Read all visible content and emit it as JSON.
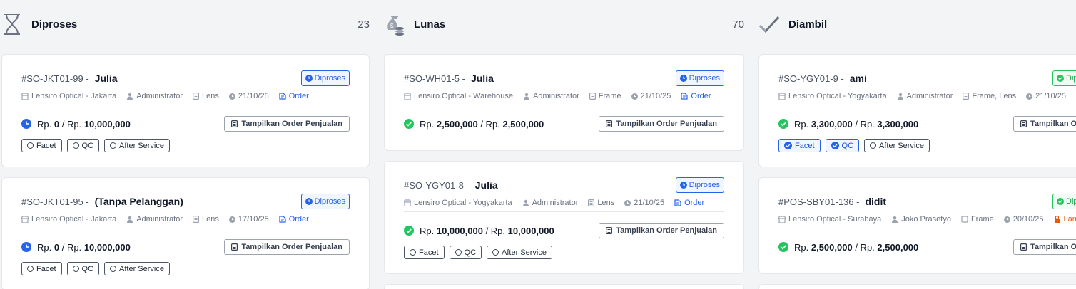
{
  "columns": [
    {
      "title": "Diproses",
      "count": "23",
      "icon": "hourglass-icon",
      "cards": [
        {
          "order_no": "#SO-JKT01-99 -",
          "customer": "Julia",
          "status": "Diproses",
          "branch": "Lensiro Optical - Jakarta",
          "user": "Administrator",
          "items": "Lens",
          "date": "21/10/25",
          "type": "Order",
          "paid_prefix": "Rp.",
          "paid": "0",
          "separator": "/ Rp.",
          "total": "10,000,000",
          "button": "Tampilkan Order Penjualan",
          "chips": [
            {
              "label": "Facet",
              "checked": false
            },
            {
              "label": "QC",
              "checked": false
            },
            {
              "label": "After Service",
              "checked": false
            }
          ]
        },
        {
          "order_no": "#SO-JKT01-95 -",
          "customer": "(Tanpa Pelanggan)",
          "status": "Diproses",
          "branch": "Lensiro Optical - Jakarta",
          "user": "Administrator",
          "items": "Lens",
          "date": "17/10/25",
          "type": "Order",
          "paid_prefix": "Rp.",
          "paid": "0",
          "separator": "/ Rp.",
          "total": "10,000,000",
          "button": "Tampilkan Order Penjualan",
          "chips": [
            {
              "label": "Facet",
              "checked": false
            },
            {
              "label": "QC",
              "checked": false
            },
            {
              "label": "After Service",
              "checked": false
            }
          ]
        }
      ]
    },
    {
      "title": "Lunas",
      "count": "70",
      "icon": "money-bag-icon",
      "cards": [
        {
          "order_no": "#SO-WH01-5 -",
          "customer": "Julia",
          "status": "Diproses",
          "branch": "Lensiro Optical - Warehouse",
          "user": "Administrator",
          "items": "Frame",
          "date": "21/10/25",
          "type": "Order",
          "paid_prefix": "Rp.",
          "paid": "2,500,000",
          "separator": "/ Rp.",
          "total": "2,500,000",
          "button": "Tampilkan Order Penjualan"
        },
        {
          "order_no": "#SO-YGY01-8 -",
          "customer": "Julia",
          "status": "Diproses",
          "branch": "Lensiro Optical - Yogyakarta",
          "user": "Administrator",
          "items": "Lens",
          "date": "21/10/25",
          "type": "Order",
          "paid_prefix": "Rp.",
          "paid": "10,000,000",
          "separator": "/ Rp.",
          "total": "10,000,000",
          "button": "Tampilkan Order Penjualan",
          "chips": [
            {
              "label": "Facet",
              "checked": false
            },
            {
              "label": "QC",
              "checked": false
            },
            {
              "label": "After Service",
              "checked": false
            }
          ]
        }
      ]
    },
    {
      "title": "Diambil",
      "icon": "check-icon",
      "cards": [
        {
          "order_no": "#SO-YGY01-9 -",
          "customer": "ami",
          "status": "Diproses",
          "branch": "Lensiro Optical - Yogyakarta",
          "user": "Administrator",
          "items": "Frame, Lens",
          "date": "21/10/25",
          "paid_prefix": "Rp.",
          "paid": "3,300,000",
          "separator": "/ Rp.",
          "total": "3,300,000",
          "button": "Tampilkan Order Penjualan",
          "chips": [
            {
              "label": "Facet",
              "checked": true
            },
            {
              "label": "QC",
              "checked": true
            },
            {
              "label": "After Service",
              "checked": false
            }
          ]
        },
        {
          "order_no": "#POS-SBY01-136 -",
          "customer": "didit",
          "status": "Diproses",
          "branch": "Lensiro Optical - Surabaya",
          "user": "Joko Prasetyo",
          "items": "Frame",
          "date": "20/10/25",
          "type": "Langsung",
          "paid_prefix": "Rp.",
          "paid": "2,500,000",
          "separator": "/ Rp.",
          "total": "2,500,000",
          "button": "Tampilkan Order Penjualan"
        }
      ]
    }
  ],
  "colors": {
    "accent": "#2563eb",
    "success": "#22c55e",
    "warning": "#ea580c",
    "background": "#f3f4f6"
  }
}
